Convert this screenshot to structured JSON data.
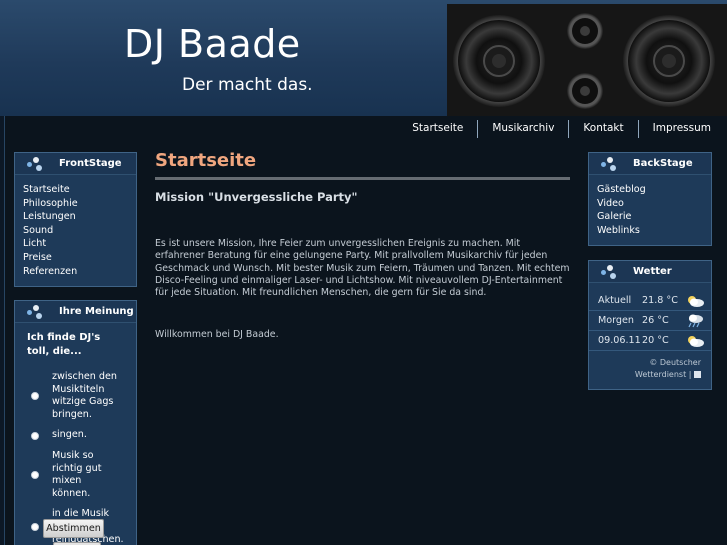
{
  "header": {
    "title": "DJ Baade",
    "slogan": "Der macht das."
  },
  "nav": {
    "items": [
      "Startseite",
      "Musikarchiv",
      "Kontakt",
      "Impressum"
    ]
  },
  "frontstage": {
    "title": "FrontStage",
    "items": [
      "Startseite",
      "Philosophie",
      "Leistungen",
      "Sound",
      "Licht",
      "Preise",
      "Referenzen"
    ]
  },
  "backstage": {
    "title": "BackStage",
    "items": [
      "Gästeblog",
      "Video",
      "Galerie",
      "Weblinks"
    ]
  },
  "poll": {
    "title": "Ihre Meinung",
    "question": "Ich finde DJ's toll, die...",
    "options": [
      "zwischen den Musiktiteln witzige Gags bringen.",
      "singen.",
      "Musik so richtig gut mixen können.",
      "in die Musik nicht reinquatschen."
    ],
    "vote_label": "Abstimmen"
  },
  "weather": {
    "title": "Wetter",
    "rows": [
      {
        "label": "Aktuell",
        "temp": "21.8 °C",
        "icon": "partly-cloudy-icon"
      },
      {
        "label": "Morgen",
        "temp": "26 °C",
        "icon": "cloudy-rain-icon"
      },
      {
        "label": "09.06.11",
        "temp": "20 °C",
        "icon": "partly-cloudy-icon"
      }
    ],
    "credit_line1": "© Deutscher",
    "credit_line2": "Wetterdienst |"
  },
  "main": {
    "page_title": "Startseite",
    "subtitle": "Mission \"Unvergessliche Party\"",
    "intro": "Es ist unsere Mission, Ihre Feier zum unvergesslichen Ereignis zu machen. Mit erfahrener Beratung für eine gelungene Party. Mit prallvollem Musikarchiv für jeden Geschmack und Wunsch. Mit bester Musik zum Feiern, Träumen und Tanzen. Mit echtem Disco-Feeling und einmaliger Laser- und Lichtshow. Mit niveauvollem DJ-Entertainment für jede Situation. Mit freundlichen Menschen, die gern für Sie da sind.",
    "welcome": "Willkommen bei DJ Baade."
  },
  "colors": {
    "header_bg": "#1f3a5a",
    "box_bg": "#1e3a59",
    "page_title": "#f0a67f",
    "page_bg": "#0b141d"
  }
}
